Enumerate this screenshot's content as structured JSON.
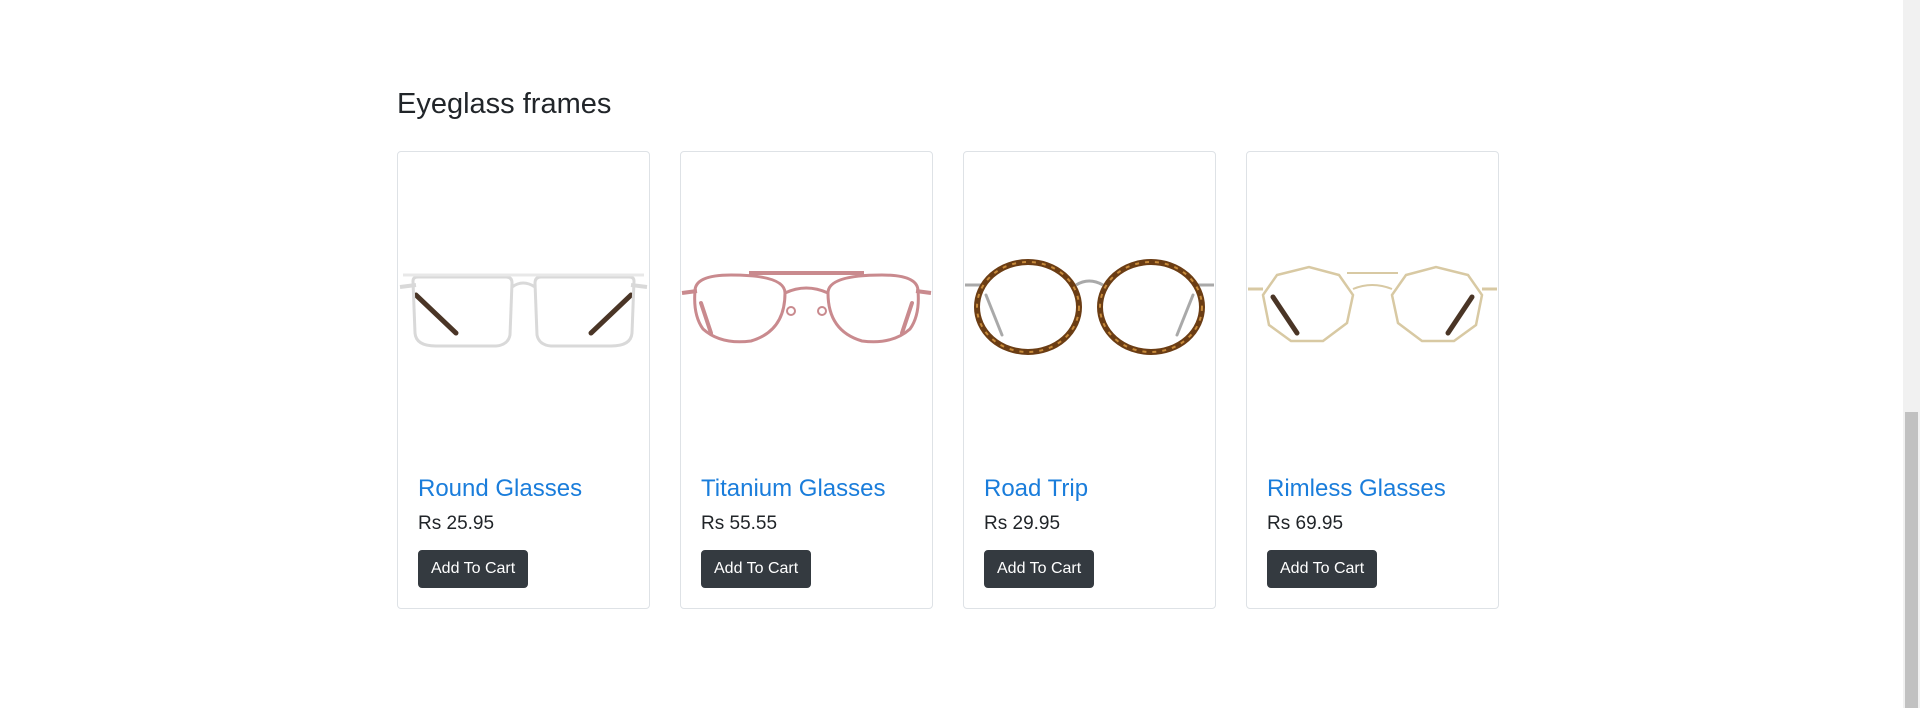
{
  "section": {
    "title": "Eyeglass frames"
  },
  "products": [
    {
      "name": "Round Glasses",
      "price": "Rs 25.95",
      "button_label": "Add To Cart",
      "frame_color": "#d9d9d9",
      "temple_color": "#4a3526"
    },
    {
      "name": "Titanium Glasses",
      "price": "Rs 55.55",
      "button_label": "Add To Cart",
      "frame_color": "#c98a8e",
      "temple_color": "#c98a8e"
    },
    {
      "name": "Road Trip",
      "price": "Rs 29.95",
      "button_label": "Add To Cart",
      "frame_color": "#6b3d14",
      "temple_color": "#a9a9a9"
    },
    {
      "name": "Rimless Glasses",
      "price": "Rs 69.95",
      "button_label": "Add To Cart",
      "frame_color": "#d8c9a3",
      "temple_color": "#4a3526"
    }
  ],
  "colors": {
    "title_link": "#1a7ddb",
    "button_bg": "#343a40",
    "card_border": "#dee2e6"
  }
}
